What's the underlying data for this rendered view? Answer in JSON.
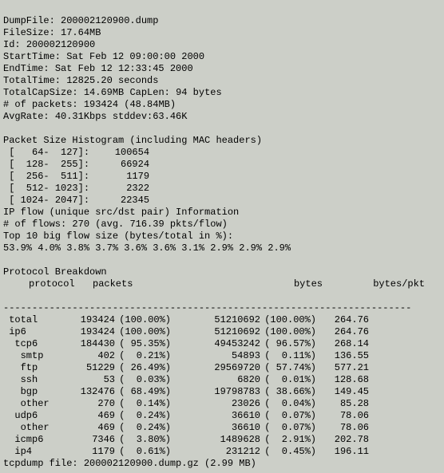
{
  "header": {
    "dumpfile_label": "DumpFile: ",
    "dumpfile": "200002120900.dump",
    "filesize_label": "FileSize: ",
    "filesize": "17.64MB",
    "id_label": "Id: ",
    "id": "200002120900",
    "starttime_label": "StartTime: ",
    "starttime": "Sat Feb 12 09:00:00 2000",
    "endtime_label": "EndTime: ",
    "endtime": "Sat Feb 12 12:33:45 2000",
    "totaltime_label": "TotalTime: ",
    "totaltime": "12825.20 seconds",
    "totalcap_label": "TotalCapSize: ",
    "totalcap": "14.69MB",
    "caplen_label": " CapLen: ",
    "caplen": "94 bytes",
    "packets_label": "# of packets: ",
    "packets": "193424 (48.84MB)",
    "avgrate_label": "AvgRate: ",
    "avgrate": "40.31Kbps stddev:63.46K"
  },
  "histogram": {
    "title": "Packet Size Histogram (including MAC headers)",
    "rows": [
      {
        "range": "[   64-  127]:",
        "count": "100654"
      },
      {
        "range": "[  128-  255]:",
        "count": "66924"
      },
      {
        "range": "[  256-  511]:",
        "count": "1179"
      },
      {
        "range": "[  512- 1023]:",
        "count": "2322"
      },
      {
        "range": "[ 1024- 2047]:",
        "count": "22345"
      }
    ]
  },
  "ipflow": {
    "title": "IP flow (unique src/dst pair) Information",
    "flows_label": "# of flows: ",
    "flows": "270",
    "flows_avg": " (avg. 716.39 pkts/flow)",
    "top_label": "Top 10 big flow size (bytes/total in %):",
    "top_values": "53.9% 4.0% 3.8% 3.7% 3.6% 3.6% 3.1% 2.9% 2.9% 2.9%"
  },
  "breakdown": {
    "title": "Protocol Breakdown",
    "cols": {
      "c1": "protocol",
      "c2": "packets",
      "c3": "bytes",
      "c4": "bytes/pkt"
    },
    "sep": "-----------------------------------------------------------------------",
    "rows": [
      {
        "name": " total",
        "pkts": "193424",
        "ppct": "(100.00%)",
        "bytes": "51210692",
        "bpct": "(100.00%)",
        "bpp": "264.76"
      },
      {
        "name": " ip6",
        "pkts": "193424",
        "ppct": "(100.00%)",
        "bytes": "51210692",
        "bpct": "(100.00%)",
        "bpp": "264.76"
      },
      {
        "name": "  tcp6",
        "pkts": "184430",
        "ppct": "( 95.35%)",
        "bytes": "49453242",
        "bpct": "( 96.57%)",
        "bpp": "268.14"
      },
      {
        "name": "   smtp",
        "pkts": "402",
        "ppct": "(  0.21%)",
        "bytes": "54893",
        "bpct": "(  0.11%)",
        "bpp": "136.55"
      },
      {
        "name": "   ftp",
        "pkts": "51229",
        "ppct": "( 26.49%)",
        "bytes": "29569720",
        "bpct": "( 57.74%)",
        "bpp": "577.21"
      },
      {
        "name": "   ssh",
        "pkts": "53",
        "ppct": "(  0.03%)",
        "bytes": "6820",
        "bpct": "(  0.01%)",
        "bpp": "128.68"
      },
      {
        "name": "   bgp",
        "pkts": "132476",
        "ppct": "( 68.49%)",
        "bytes": "19798783",
        "bpct": "( 38.66%)",
        "bpp": "149.45"
      },
      {
        "name": "   other",
        "pkts": "270",
        "ppct": "(  0.14%)",
        "bytes": "23026",
        "bpct": "(  0.04%)",
        "bpp": "85.28"
      },
      {
        "name": "  udp6",
        "pkts": "469",
        "ppct": "(  0.24%)",
        "bytes": "36610",
        "bpct": "(  0.07%)",
        "bpp": "78.06"
      },
      {
        "name": "   other",
        "pkts": "469",
        "ppct": "(  0.24%)",
        "bytes": "36610",
        "bpct": "(  0.07%)",
        "bpp": "78.06"
      },
      {
        "name": "  icmp6",
        "pkts": "7346",
        "ppct": "(  3.80%)",
        "bytes": "1489628",
        "bpct": "(  2.91%)",
        "bpp": "202.78"
      },
      {
        "name": "  ip4",
        "pkts": "1179",
        "ppct": "(  0.61%)",
        "bytes": "231212",
        "bpct": "(  0.45%)",
        "bpp": "196.11"
      }
    ]
  },
  "footer": {
    "label": "tcpdump file: ",
    "file": "200002120900.dump.gz",
    "size": " (2.99 MB)"
  }
}
